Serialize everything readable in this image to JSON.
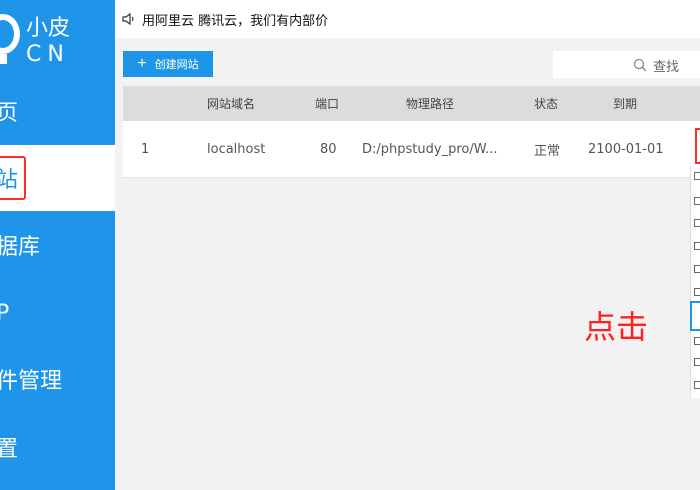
{
  "app": {
    "logo_name": "小皮",
    "logo_cn": "CN"
  },
  "sidebar": {
    "items": [
      {
        "label": "页"
      },
      {
        "label": "站"
      },
      {
        "label": "据库"
      },
      {
        "label": "P"
      },
      {
        "label": "件管理"
      },
      {
        "label": "置"
      }
    ]
  },
  "notice": {
    "text": "用阿里云 腾讯云，我们有内部价"
  },
  "toolbar": {
    "create_label": "创建网站",
    "search_label": "查找"
  },
  "table": {
    "headers": [
      "网站域名",
      "端口",
      "物理路径",
      "状态",
      "到期"
    ],
    "rows": [
      {
        "index": "1",
        "domain": "localhost",
        "port": "80",
        "path": "D:/phpstudy_pro/W...",
        "status": "正常",
        "expire": "2100-01-01"
      }
    ]
  },
  "annotation": {
    "click_note": "点击"
  },
  "colors": {
    "brand": "#1e95e8",
    "highlight": "#ff2a2a"
  }
}
